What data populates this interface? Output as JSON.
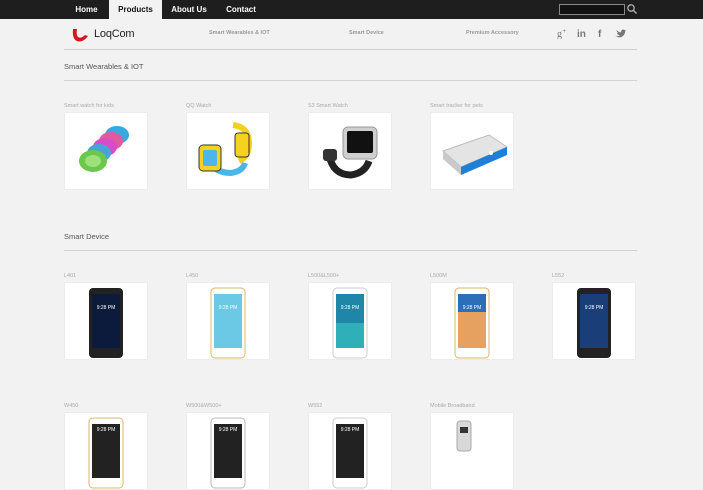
{
  "nav": {
    "items": [
      {
        "label": "Home"
      },
      {
        "label": "Products"
      },
      {
        "label": "About Us"
      },
      {
        "label": "Contact"
      }
    ]
  },
  "search": {
    "placeholder": ""
  },
  "header": {
    "brand": "LoqCom",
    "categories": [
      "Smart Wearables & IOT",
      "Smart Device",
      "Premium Accessory"
    ]
  },
  "sections": {
    "wearables": {
      "title": "Smart Wearables & IOT",
      "products": [
        "Smart watch for kids",
        "QQ Watch",
        "S3 Smart Watch",
        "Smart tracker for pets"
      ]
    },
    "devices": {
      "title": "Smart Device",
      "products": [
        "L401",
        "L450",
        "L500&L500+",
        "L500M",
        "L552"
      ],
      "more_products": [
        "W450",
        "W500&W500+",
        "W552",
        "Mobile Broadband"
      ]
    }
  },
  "phone_time": "9:28 PM",
  "colors": {
    "topbar": "#1e1e1e",
    "brand_red": "#d9141b",
    "background": "#f2f2f2"
  }
}
